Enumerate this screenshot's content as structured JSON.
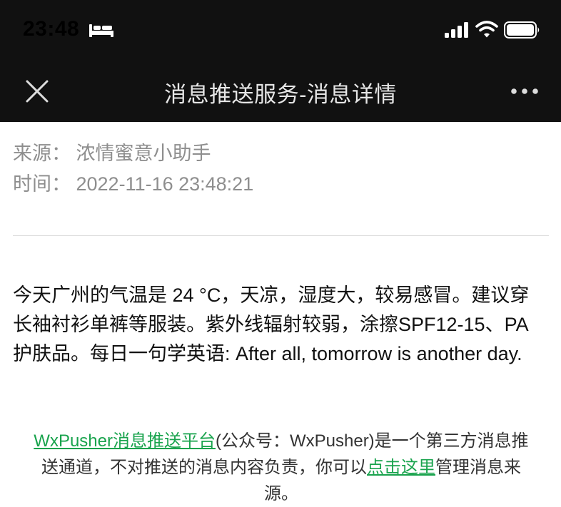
{
  "status_bar": {
    "time": "23:48",
    "icons": [
      "bed-icon",
      "signal-icon",
      "wifi-icon",
      "battery-icon"
    ]
  },
  "nav": {
    "title": "消息推送服务-消息详情",
    "close_icon": "close-icon",
    "more_icon": "more-icon"
  },
  "meta": {
    "source": "来源：  浓情蜜意小助手",
    "time": "时间：  2022-11-16 23:48:21"
  },
  "message": {
    "body": "今天广州的气温是 24 °C，天凉，湿度大，较易感冒。建议穿长袖衬衫单裤等服装。紫外线辐射较弱，涂擦SPF12-15、PA 护肤品。每日一句学英语: After all, tomorrow is another day."
  },
  "footer": {
    "link1": "WxPusher消息推送平台",
    "text1": "(公众号：WxPusher)是一个第三方消息推送通道，不对推送的消息内容负责，你可以",
    "link2": "点击这里",
    "text2": "管理消息来源。"
  },
  "colors": {
    "header_bg": "#111111",
    "link": "#19a34d",
    "meta_text": "#8e8e8e"
  }
}
